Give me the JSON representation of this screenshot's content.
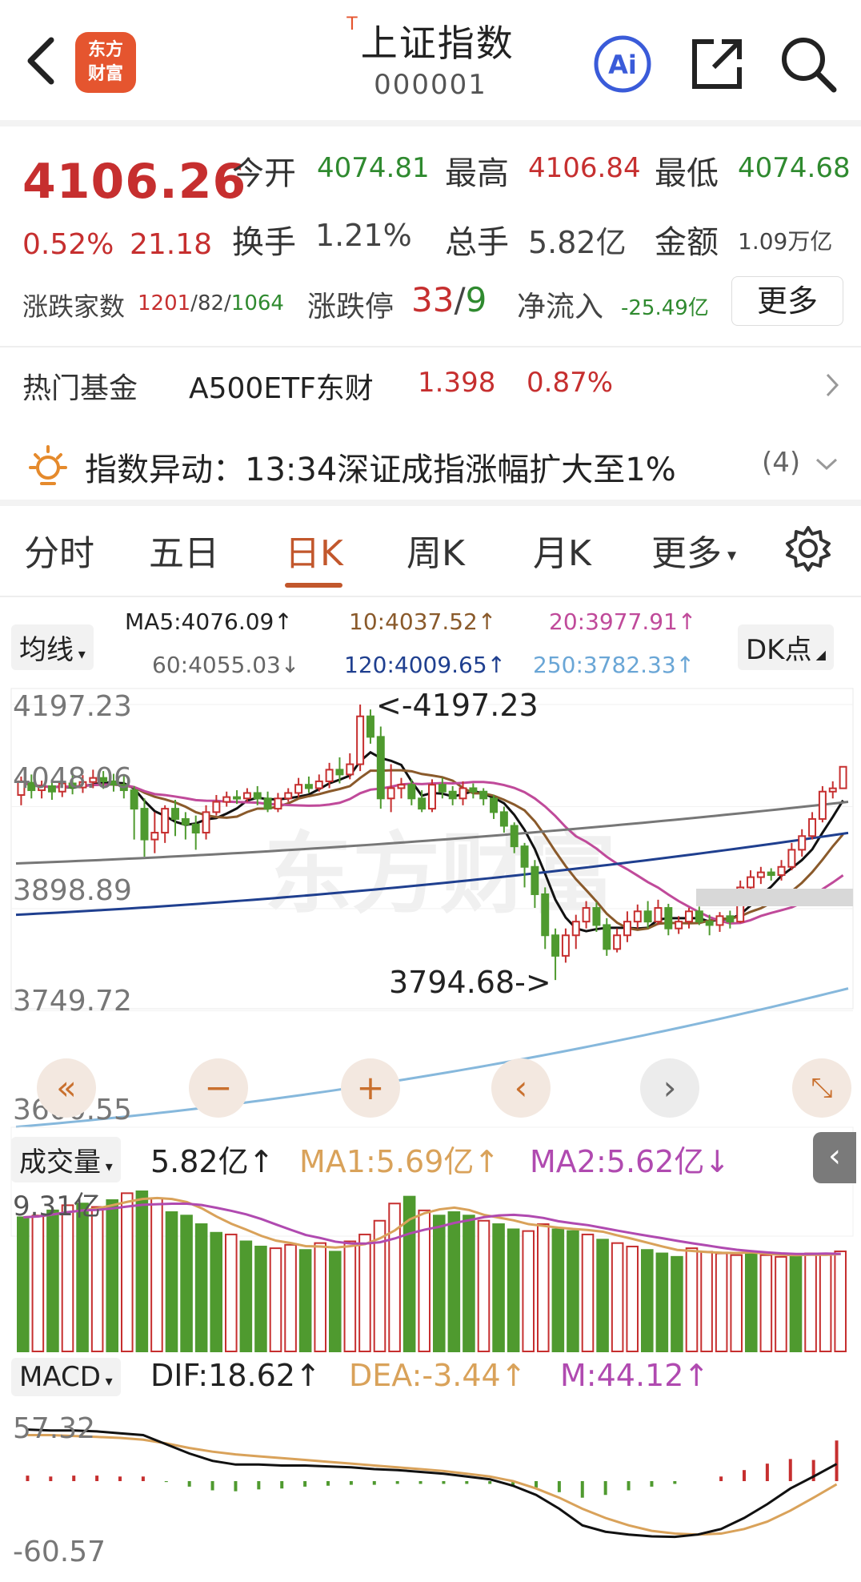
{
  "header": {
    "title": "上证指数",
    "t_mark": "T",
    "code": "000001",
    "logo_line1": "东方",
    "logo_line2": "财富",
    "ai_label": "Ai"
  },
  "quote": {
    "price": "4106.26",
    "change_pct": "0.52%",
    "change_abs": "21.18",
    "open_label": "今开",
    "open": "4074.81",
    "high_label": "最高",
    "high": "4106.84",
    "low_label": "最低",
    "low": "4074.68",
    "turnover_label": "换手",
    "turnover": "1.21%",
    "volume_label": "总手",
    "volume": "5.82亿",
    "amount_label": "金额",
    "amount": "1.09万亿",
    "breadth_label": "涨跌家数",
    "breadth_up": "1201",
    "breadth_flat": "82",
    "breadth_down": "1064",
    "slash": "/",
    "limit_label": "涨跌停",
    "limit_up": "33",
    "limit_down": "9",
    "inflow_label": "净流入",
    "inflow": "-25.49亿",
    "more": "更多"
  },
  "fund": {
    "label": "热门基金",
    "name": "A500ETF东财",
    "price": "1.398",
    "pct": "0.87%"
  },
  "alert": {
    "label": "指数异动：",
    "text": "13:34深证成指涨幅扩大至1%",
    "count": "(4)"
  },
  "tabs": [
    "分时",
    "五日",
    "日K",
    "周K",
    "月K",
    "更多"
  ],
  "active_tab": 2,
  "ma_bar": {
    "selector": "均线",
    "dk": "DK点",
    "ma5": "MA5:4076.09↑",
    "ma10": "10:4037.52↑",
    "ma20": "20:3977.91↑",
    "ma60": "60:4055.03↓",
    "ma120": "120:4009.65↑",
    "ma250": "250:3782.33↑"
  },
  "price_axis": [
    "4197.23",
    "4048.06",
    "3898.89",
    "3749.72",
    "3600.55"
  ],
  "annotations": {
    "high": "<-4197.23",
    "low": "3794.68->"
  },
  "watermark": "东方财富",
  "volume_bar": {
    "selector": "成交量",
    "vol": "5.82亿↑",
    "ma1": "MA1:5.69亿↑",
    "ma2": "MA2:5.62亿↓",
    "top": "9.31亿"
  },
  "macd_bar": {
    "selector": "MACD",
    "dif": "DIF:18.62↑",
    "dea": "DEA:-3.44↑",
    "m": "M:44.12↑",
    "top": "57.32",
    "bottom": "-60.57"
  },
  "colors": {
    "up": "#c62f2f",
    "down": "#4f9a2f",
    "ma5": "#111111",
    "ma10": "#8a5a2b",
    "ma20": "#c04a9a",
    "ma60": "#777777",
    "ma120": "#1f3f8f",
    "ma250": "#86b8dc",
    "accent": "#c2572c"
  },
  "chart_data": {
    "type": "candlestick",
    "y_range": [
      3600.55,
      4197.23
    ],
    "candles": [
      [
        4065,
        4085,
        4050,
        4092
      ],
      [
        4083,
        4072,
        4060,
        4095
      ],
      [
        4072,
        4078,
        4060,
        4086
      ],
      [
        4078,
        4070,
        4058,
        4088
      ],
      [
        4070,
        4082,
        4062,
        4090
      ],
      [
        4082,
        4076,
        4066,
        4098
      ],
      [
        4076,
        4084,
        4068,
        4094
      ],
      [
        4084,
        4090,
        4075,
        4102
      ],
      [
        4090,
        4085,
        4074,
        4100
      ],
      [
        4085,
        4080,
        4070,
        4096
      ],
      [
        4080,
        4072,
        4060,
        4094
      ],
      [
        4072,
        4045,
        4000,
        4078
      ],
      [
        4045,
        4000,
        3975,
        4060
      ],
      [
        4000,
        4010,
        3980,
        4040
      ],
      [
        4010,
        4045,
        3995,
        4050
      ],
      [
        4045,
        4030,
        4005,
        4058
      ],
      [
        4030,
        4022,
        4000,
        4040
      ],
      [
        4022,
        4010,
        3985,
        4035
      ],
      [
        4010,
        4040,
        4000,
        4050
      ],
      [
        4040,
        4055,
        4035,
        4065
      ],
      [
        4055,
        4062,
        4048,
        4070
      ],
      [
        4062,
        4060,
        4052,
        4072
      ],
      [
        4060,
        4068,
        4055,
        4075
      ],
      [
        4068,
        4060,
        4050,
        4078
      ],
      [
        4060,
        4045,
        4040,
        4070
      ],
      [
        4045,
        4060,
        4040,
        4068
      ],
      [
        4060,
        4068,
        4055,
        4075
      ],
      [
        4068,
        4080,
        4062,
        4090
      ],
      [
        4080,
        4075,
        4068,
        4092
      ],
      [
        4075,
        4085,
        4070,
        4095
      ],
      [
        4085,
        4102,
        4075,
        4112
      ],
      [
        4102,
        4095,
        4082,
        4120
      ],
      [
        4095,
        4110,
        4088,
        4126
      ],
      [
        4110,
        4180,
        4100,
        4197.23
      ],
      [
        4180,
        4150,
        4140,
        4190
      ],
      [
        4150,
        4060,
        4045,
        4165
      ],
      [
        4060,
        4075,
        4040,
        4110
      ],
      [
        4075,
        4080,
        4060,
        4090
      ],
      [
        4080,
        4060,
        4050,
        4088
      ],
      [
        4060,
        4045,
        4040,
        4072
      ],
      [
        4045,
        4080,
        4040,
        4088
      ],
      [
        4080,
        4070,
        4060,
        4090
      ],
      [
        4070,
        4060,
        4050,
        4078
      ],
      [
        4060,
        4075,
        4050,
        4085
      ],
      [
        4075,
        4070,
        4060,
        4082
      ],
      [
        4070,
        4060,
        4050,
        4075
      ],
      [
        4060,
        4040,
        4030,
        4065
      ],
      [
        4040,
        4020,
        4010,
        4048
      ],
      [
        4020,
        3990,
        3980,
        4025
      ],
      [
        3990,
        3960,
        3930,
        3995
      ],
      [
        3960,
        3920,
        3900,
        3970
      ],
      [
        3920,
        3860,
        3840,
        3930
      ],
      [
        3860,
        3830,
        3794.68,
        3870
      ],
      [
        3830,
        3860,
        3820,
        3870
      ],
      [
        3860,
        3880,
        3840,
        3890
      ],
      [
        3880,
        3900,
        3870,
        3910
      ],
      [
        3900,
        3875,
        3865,
        3908
      ],
      [
        3875,
        3840,
        3830,
        3885
      ],
      [
        3840,
        3860,
        3835,
        3870
      ],
      [
        3860,
        3880,
        3850,
        3895
      ],
      [
        3880,
        3895,
        3870,
        3905
      ],
      [
        3895,
        3880,
        3870,
        3910
      ],
      [
        3880,
        3900,
        3875,
        3912
      ],
      [
        3900,
        3870,
        3860,
        3906
      ],
      [
        3870,
        3880,
        3862,
        3888
      ],
      [
        3880,
        3895,
        3870,
        3900
      ],
      [
        3895,
        3880,
        3875,
        3902
      ],
      [
        3880,
        3875,
        3860,
        3890
      ],
      [
        3875,
        3888,
        3865,
        3894
      ],
      [
        3888,
        3880,
        3870,
        3896
      ],
      [
        3880,
        3930,
        3878,
        3940
      ],
      [
        3930,
        3945,
        3920,
        3955
      ],
      [
        3945,
        3952,
        3935,
        3960
      ],
      [
        3952,
        3948,
        3940,
        3958
      ],
      [
        3948,
        3960,
        3940,
        3970
      ],
      [
        3960,
        3985,
        3955,
        3995
      ],
      [
        3985,
        4005,
        3975,
        4015
      ],
      [
        4005,
        4030,
        4000,
        4040
      ],
      [
        4030,
        4070,
        4025,
        4078
      ],
      [
        4070,
        4074.81,
        4060,
        4085
      ],
      [
        4074.81,
        4106.26,
        4074.68,
        4106.84
      ]
    ],
    "volume": [
      [
        7.8,
        0
      ],
      [
        7.9,
        1
      ],
      [
        8.2,
        0
      ],
      [
        8.5,
        1
      ],
      [
        8.6,
        0
      ],
      [
        8.4,
        1
      ],
      [
        8.8,
        0
      ],
      [
        9.2,
        1
      ],
      [
        9.31,
        0
      ],
      [
        8.9,
        1
      ],
      [
        8.1,
        0
      ],
      [
        7.9,
        0
      ],
      [
        7.4,
        0
      ],
      [
        6.9,
        0
      ],
      [
        6.8,
        1
      ],
      [
        6.4,
        0
      ],
      [
        6.1,
        0
      ],
      [
        6.0,
        1
      ],
      [
        6.2,
        1
      ],
      [
        5.9,
        0
      ],
      [
        6.3,
        1
      ],
      [
        5.8,
        0
      ],
      [
        6.4,
        1
      ],
      [
        6.8,
        1
      ],
      [
        7.6,
        1
      ],
      [
        8.6,
        1
      ],
      [
        9.0,
        0
      ],
      [
        8.2,
        1
      ],
      [
        7.9,
        0
      ],
      [
        8.1,
        0
      ],
      [
        7.9,
        0
      ],
      [
        7.6,
        1
      ],
      [
        7.4,
        0
      ],
      [
        7.1,
        0
      ],
      [
        7.0,
        1
      ],
      [
        7.4,
        1
      ],
      [
        7.1,
        0
      ],
      [
        7.0,
        0
      ],
      [
        6.8,
        1
      ],
      [
        6.5,
        0
      ],
      [
        6.3,
        1
      ],
      [
        6.1,
        1
      ],
      [
        5.9,
        0
      ],
      [
        5.7,
        0
      ],
      [
        5.5,
        0
      ],
      [
        6.0,
        1
      ],
      [
        5.8,
        1
      ],
      [
        5.7,
        1
      ],
      [
        5.6,
        1
      ],
      [
        5.7,
        0
      ],
      [
        5.6,
        1
      ],
      [
        5.5,
        1
      ],
      [
        5.6,
        0
      ],
      [
        5.7,
        1
      ],
      [
        5.69,
        1
      ],
      [
        5.82,
        1
      ]
    ],
    "macd": {
      "dif": [
        56,
        55,
        55,
        54,
        52,
        50,
        40,
        30,
        22,
        18,
        18,
        17,
        17,
        16,
        15,
        13,
        12,
        10,
        8,
        5,
        2,
        -5,
        -15,
        -30,
        -48,
        -55,
        -58,
        -60,
        -60.57,
        -58,
        -52,
        -40,
        -25,
        -8,
        5,
        18.62
      ],
      "dea": [
        50,
        50,
        49,
        48,
        47,
        45,
        41,
        36,
        32,
        29,
        27,
        25,
        23,
        21,
        19,
        17,
        15,
        13,
        11,
        8,
        5,
        0,
        -8,
        -18,
        -30,
        -40,
        -48,
        -54,
        -57,
        -58,
        -57,
        -52,
        -44,
        -32,
        -18,
        -3.44
      ],
      "hist": [
        6,
        5,
        6,
        6,
        5,
        5,
        -1,
        -6,
        -10,
        -11,
        -9,
        -8,
        -6,
        -5,
        -4,
        -4,
        -3,
        -3,
        -3,
        -3,
        -3,
        -5,
        -7,
        -12,
        -18,
        -15,
        -10,
        -6,
        -3,
        0,
        5,
        12,
        19,
        24,
        23,
        44.12
      ]
    }
  }
}
